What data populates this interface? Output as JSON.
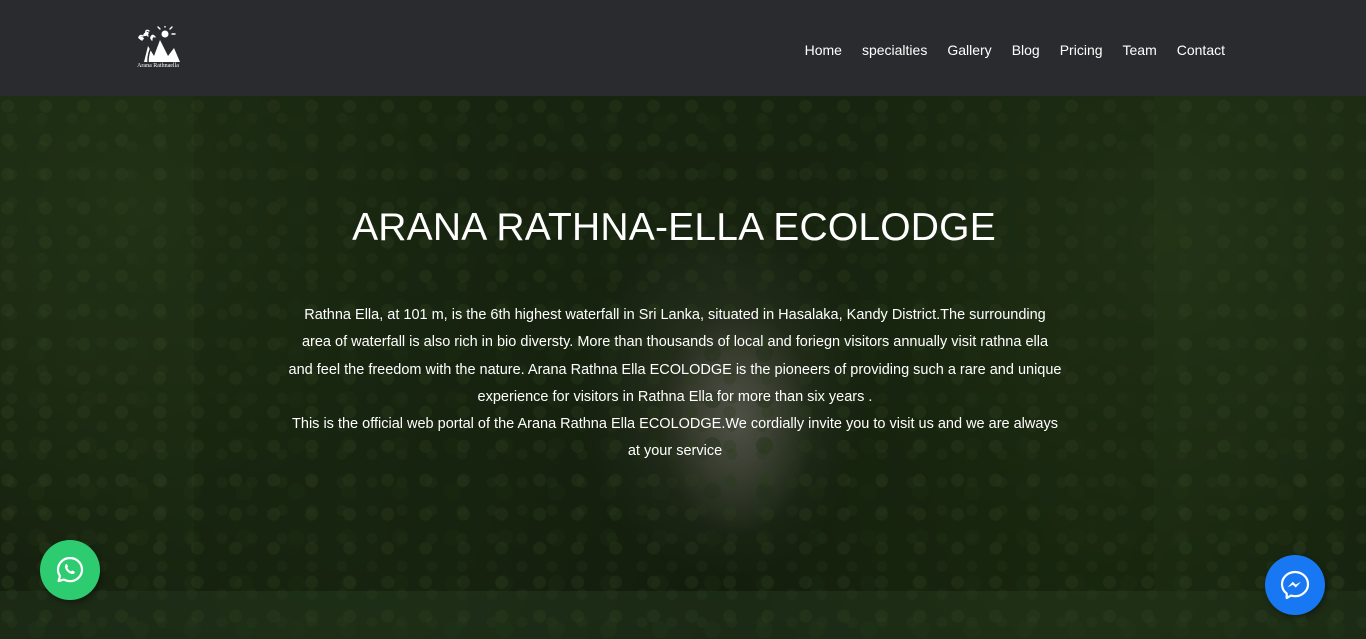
{
  "header": {
    "logo_text": "Arana Rathnaella",
    "nav": [
      {
        "label": "Home"
      },
      {
        "label": "specialties"
      },
      {
        "label": "Gallery"
      },
      {
        "label": "Blog"
      },
      {
        "label": "Pricing"
      },
      {
        "label": "Team"
      },
      {
        "label": "Contact"
      }
    ]
  },
  "hero": {
    "title": "ARANA RATHNA-ELLA ECOLODGE",
    "paragraph_1": "Rathna Ella, at 101 m, is the 6th highest waterfall in Sri Lanka, situated in Hasalaka, Kandy District.The surrounding area of waterfall is also rich in bio diversty. More than thousands of local and foriegn visitors annually visit rathna ella and feel the freedom with the nature. Arana Rathna Ella ECOLODGE is the pioneers of providing such a rare and unique experience for visitors in Rathna Ella for more than six years .",
    "paragraph_2": "This is the official web portal of the Arana Rathna Ella ECOLODGE.We cordially invite you to visit us and we are always at your service"
  },
  "floating": {
    "whatsapp_icon": "whatsapp-icon",
    "messenger_icon": "messenger-icon"
  },
  "colors": {
    "navbar_bg": "#2a2b2f",
    "whatsapp": "#2ecc71",
    "messenger": "#1877f2"
  }
}
